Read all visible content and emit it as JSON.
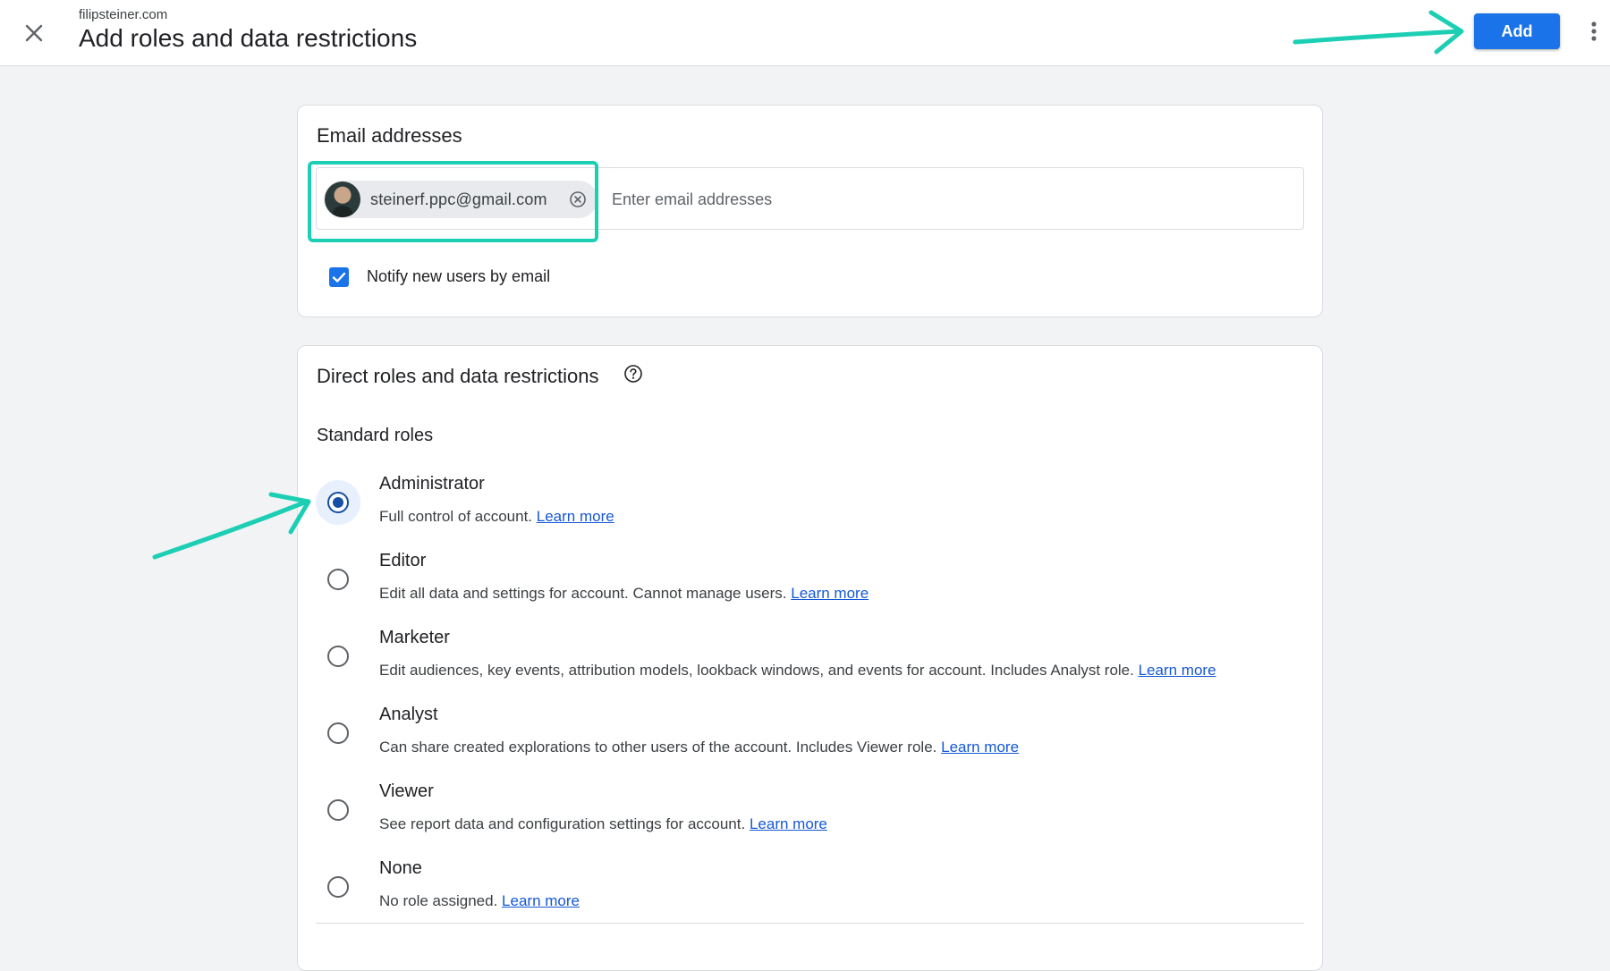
{
  "header": {
    "subtitle": "filipsteiner.com",
    "title": "Add roles and data restrictions",
    "add_label": "Add",
    "close_icon": "close-icon",
    "more_icon": "more-vert-icon"
  },
  "email_section": {
    "title": "Email addresses",
    "chip_email": "steinerf.ppc@gmail.com",
    "input_placeholder": "Enter email addresses",
    "input_value": "",
    "notify_label": "Notify new users by email",
    "notify_checked": true
  },
  "roles_section": {
    "title": "Direct roles and data restrictions",
    "standard_roles_label": "Standard roles",
    "learn_more": "Learn more",
    "selected": "Administrator",
    "roles": [
      {
        "name": "Administrator",
        "description": "Full control of account."
      },
      {
        "name": "Editor",
        "description": "Edit all data and settings for account. Cannot manage users."
      },
      {
        "name": "Marketer",
        "description": "Edit audiences, key events, attribution models, lookback windows, and events for account. Includes Analyst role."
      },
      {
        "name": "Analyst",
        "description": "Can share created explorations to other users of the account. Includes Viewer role."
      },
      {
        "name": "Viewer",
        "description": "See report data and configuration settings for account."
      },
      {
        "name": "None",
        "description": "No role assigned."
      }
    ]
  },
  "colors": {
    "primary": "#1a73e8",
    "annotation": "#1ccfb4",
    "radio_selected": "#174ea6"
  }
}
